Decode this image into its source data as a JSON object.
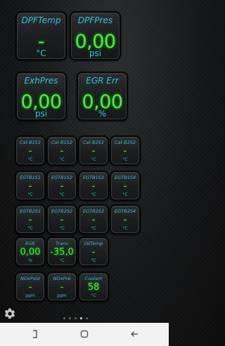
{
  "large_gauges": [
    {
      "title": "DPFTemp",
      "value": "-",
      "unit": "°C"
    },
    {
      "title": "DPFPres",
      "value": "0,00",
      "unit": "psi"
    },
    {
      "title": "ExhPres",
      "value": "0,00",
      "unit": "psi"
    },
    {
      "title": "EGR Err",
      "value": "0,00",
      "unit": "%"
    }
  ],
  "small_gauges": [
    {
      "title": "Cat B1S1",
      "value": "-",
      "unit": "°C"
    },
    {
      "title": "Cat B1S2",
      "value": "-",
      "unit": "°C"
    },
    {
      "title": "Cat B2S1",
      "value": "-",
      "unit": "°C"
    },
    {
      "title": "Cat B2S2",
      "value": "-",
      "unit": "°C"
    },
    {
      "title": "EGTB1S1",
      "value": "-",
      "unit": "°C"
    },
    {
      "title": "EGTB1S2",
      "value": "-",
      "unit": "°C"
    },
    {
      "title": "EGTB1S3",
      "value": "-",
      "unit": "°C"
    },
    {
      "title": "EGTB1S4",
      "value": "-",
      "unit": "°C"
    },
    {
      "title": "EGTB2S1",
      "value": "-",
      "unit": "°C"
    },
    {
      "title": "EGTB2S2",
      "value": "-",
      "unit": "°C"
    },
    {
      "title": "EGTB2S3",
      "value": "-",
      "unit": "°C"
    },
    {
      "title": "EGTB2S4",
      "value": "-",
      "unit": "°C"
    },
    {
      "title": "EGR",
      "value": "0,00",
      "unit": "%"
    },
    {
      "title": "Trans",
      "value": "-35,0",
      "unit": "°C"
    },
    {
      "title": "OilTemp",
      "value": "-",
      "unit": "°C"
    },
    {
      "title": "NOxPost",
      "value": "-",
      "unit": "ppm"
    },
    {
      "title": "NOxPre",
      "value": "-",
      "unit": "ppm"
    },
    {
      "title": "Coolant",
      "value": "58",
      "unit": "°C"
    }
  ],
  "page_indicator": {
    "count": 5,
    "active": 3
  },
  "colors": {
    "label": "#2ec6df",
    "value": "#39ff2e",
    "background": "#0c0d0e",
    "navbar": "#f2f2f2"
  },
  "icons": {
    "settings": "settings-gear-icon",
    "nav": [
      "recent-apps-icon",
      "home-icon",
      "back-icon"
    ]
  }
}
